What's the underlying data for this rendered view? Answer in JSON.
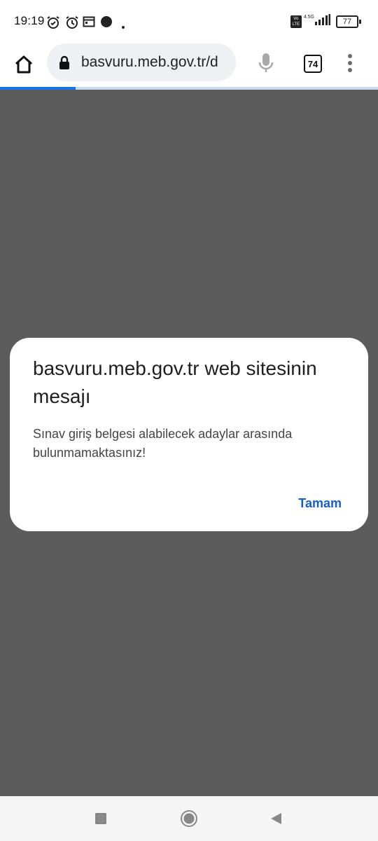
{
  "status_bar": {
    "time": "19:19",
    "network_label": "4.5G",
    "volte_label": "Vo LTE",
    "battery": "77"
  },
  "browser": {
    "url": "basvuru.meb.gov.tr/d",
    "tab_count": "74",
    "load_progress": 0.2
  },
  "dialog": {
    "title": "basvuru.meb.gov.tr web sitesinin mesajı",
    "message": "Sınav giriş belgesi alabilecek adaylar arasında bulunmamaktasınız!",
    "ok_label": "Tamam"
  },
  "colors": {
    "accent": "#1a73e8",
    "scrim": "#5c5c5c"
  }
}
